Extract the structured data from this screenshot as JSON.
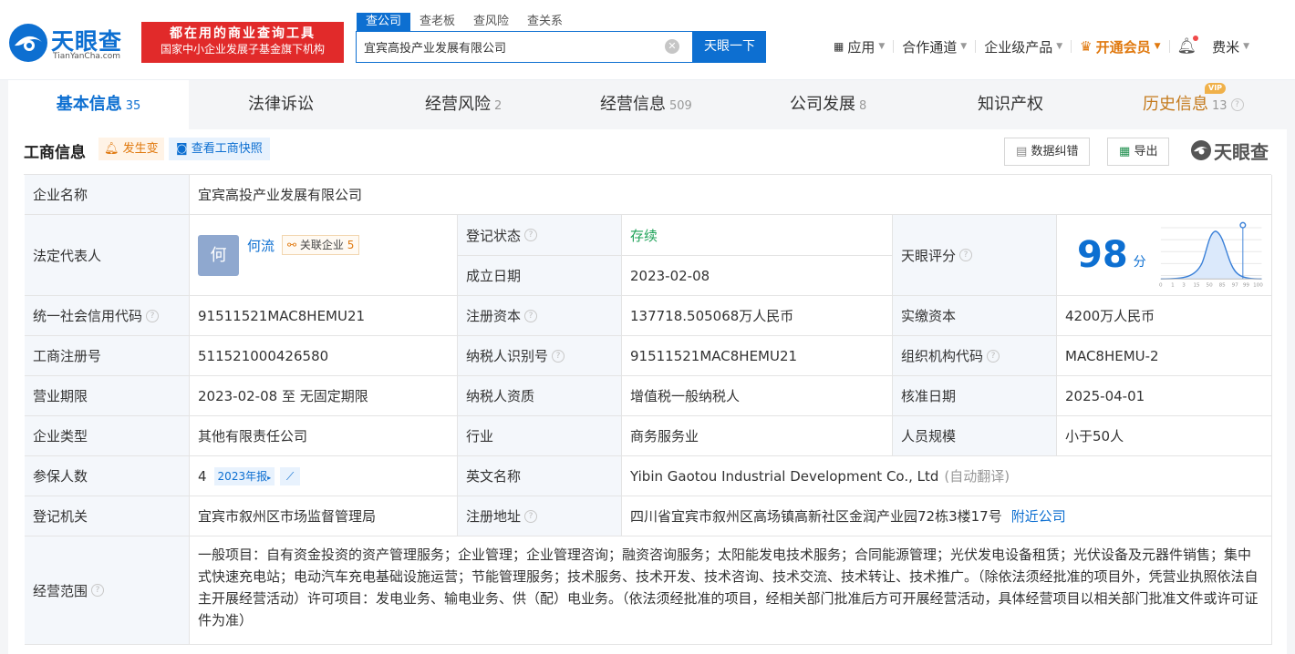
{
  "header": {
    "logo_text": "天眼查",
    "logo_sub": "TianYanCha.com",
    "slogan_line1": "都在用的商业查询工具",
    "slogan_line2": "国家中小企业发展子基金旗下机构",
    "search_tabs": [
      "查公司",
      "查老板",
      "查风险",
      "查关系"
    ],
    "search_value": "宜宾高投产业发展有限公司",
    "search_button": "天眼一下",
    "nav": {
      "apps": "应用",
      "partner": "合作通道",
      "enterprise": "企业级产品",
      "vip": "开通会员",
      "user": "费米"
    }
  },
  "tabs": [
    {
      "label": "基本信息",
      "count": "35"
    },
    {
      "label": "法律诉讼",
      "count": ""
    },
    {
      "label": "经营风险",
      "count": "2"
    },
    {
      "label": "经营信息",
      "count": "509"
    },
    {
      "label": "公司发展",
      "count": "8"
    },
    {
      "label": "知识产权",
      "count": ""
    },
    {
      "label": "历史信息",
      "count": "13",
      "badge": "VIP"
    }
  ],
  "section": {
    "title": "工商信息",
    "change_chip": "发生变",
    "snapshot_chip": "查看工商快照",
    "correction_btn": "数据纠错",
    "export_btn": "导出",
    "watermark": "天眼查"
  },
  "info": {
    "name_label": "企业名称",
    "name_value": "宜宾高投产业发展有限公司",
    "legal_label": "法定代表人",
    "legal_avatar": "何",
    "legal_name": "何流",
    "related_label": "关联企业",
    "related_count": "5",
    "status_label": "登记状态",
    "status_value": "存续",
    "founded_label": "成立日期",
    "founded_value": "2023-02-08",
    "score_label": "天眼评分",
    "score_value": "98",
    "score_unit": "分",
    "score_axis": [
      "0",
      "1",
      "3",
      "15",
      "50",
      "85",
      "97",
      "99",
      "100"
    ],
    "credit_label": "统一社会信用代码",
    "credit_value": "91511521MAC8HEMU21",
    "capital_label": "注册资本",
    "capital_value": "137718.505068万人民币",
    "paid_label": "实缴资本",
    "paid_value": "4200万人民币",
    "regno_label": "工商注册号",
    "regno_value": "511521000426580",
    "taxid_label": "纳税人识别号",
    "taxid_value": "91511521MAC8HEMU21",
    "org_label": "组织机构代码",
    "org_value": "MAC8HEMU-2",
    "term_label": "营业期限",
    "term_value": "2023-02-08 至 无固定期限",
    "taxq_label": "纳税人资质",
    "taxq_value": "增值税一般纳税人",
    "approve_label": "核准日期",
    "approve_value": "2025-04-01",
    "type_label": "企业类型",
    "type_value": "其他有限责任公司",
    "industry_label": "行业",
    "industry_value": "商务服务业",
    "staff_label": "人员规模",
    "staff_value": "小于50人",
    "insured_label": "参保人数",
    "insured_value": "4",
    "insured_year": "2023年报",
    "en_label": "英文名称",
    "en_value": "Yibin Gaotou Industrial Development Co., Ltd",
    "en_note": "(自动翻译)",
    "authority_label": "登记机关",
    "authority_value": "宜宾市叙州区市场监督管理局",
    "address_label": "注册地址",
    "address_value": "四川省宜宾市叙州区高场镇高新社区金润产业园72栋3楼17号",
    "nearby_link": "附近公司",
    "scope_label": "经营范围",
    "scope_value": "一般项目：自有资金投资的资产管理服务；企业管理；企业管理咨询；融资咨询服务；太阳能发电技术服务；合同能源管理；光伏发电设备租赁；光伏设备及元器件销售；集中式快速充电站；电动汽车充电基础设施运营；节能管理服务；技术服务、技术开发、技术咨询、技术交流、技术转让、技术推广。（除依法须经批准的项目外，凭营业执照依法自主开展经营活动）许可项目：发电业务、输电业务、供（配）电业务。（依法须经批准的项目，经相关部门批准后方可开展经营活动，具体经营项目以相关部门批准文件或许可证件为准）"
  },
  "colors": {
    "brand": "#0d6fd1",
    "status_green": "#20a35a",
    "vip_orange": "#e0790f",
    "slogan_red": "#e12a2a"
  }
}
